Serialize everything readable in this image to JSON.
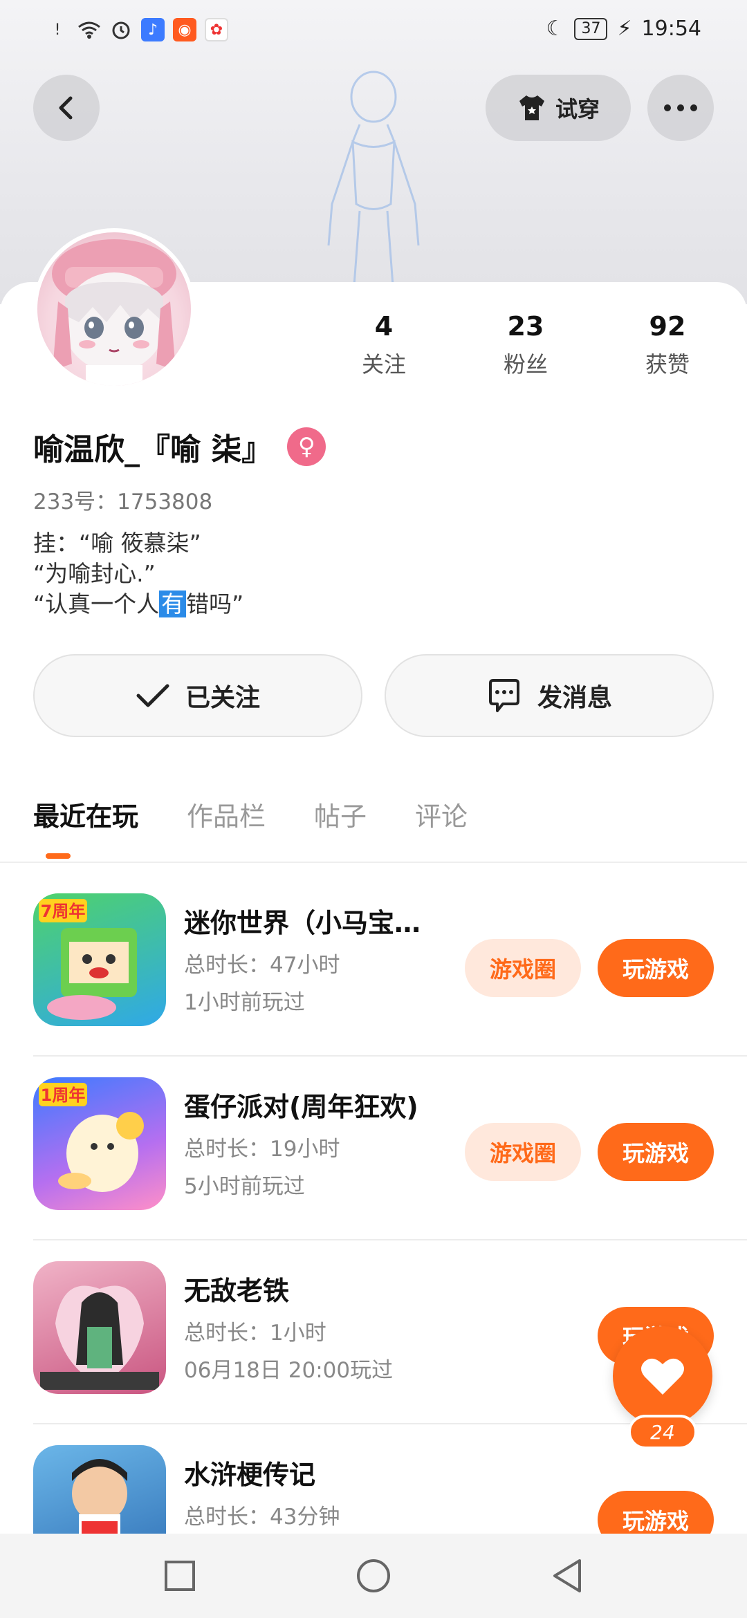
{
  "status_bar": {
    "time": "19:54",
    "battery": "37"
  },
  "header": {
    "tryon_label": "试穿"
  },
  "profile": {
    "stats": [
      {
        "value": "4",
        "label": "关注"
      },
      {
        "value": "23",
        "label": "粉丝"
      },
      {
        "value": "92",
        "label": "获赞"
      }
    ],
    "username": "喻温欣_『喻 柒』",
    "gender_symbol": "♀",
    "uid": "233号：1753808",
    "bio": {
      "line1": "挂：“喻 筱慕柒”",
      "line2": "“为喻封心.”",
      "line3_before": "“认真一个人",
      "line3_highlight": "有",
      "line3_after": "错吗”"
    }
  },
  "actions": {
    "follow_label": "已关注",
    "message_label": "发消息"
  },
  "tabs": [
    "最近在玩",
    "作品栏",
    "帖子",
    "评论"
  ],
  "games": [
    {
      "title": "迷你世界（小马宝…",
      "duration": "总时长：47小时",
      "last_played": "1小时前玩过",
      "circle_label": "游戏圈",
      "play_label": "玩游戏",
      "badge": "7周年"
    },
    {
      "title": "蛋仔派对(周年狂欢)",
      "duration": "总时长：19小时",
      "last_played": "5小时前玩过",
      "circle_label": "游戏圈",
      "play_label": "玩游戏",
      "badge": "1周年"
    },
    {
      "title": "无敌老铁",
      "duration": "总时长：1小时",
      "last_played": "06月18日 20:00玩过",
      "play_label": "玩游戏"
    },
    {
      "title": "水浒梗传记",
      "duration": "总时长：43分钟",
      "play_label": "玩游戏"
    }
  ],
  "fab": {
    "count": "24"
  }
}
